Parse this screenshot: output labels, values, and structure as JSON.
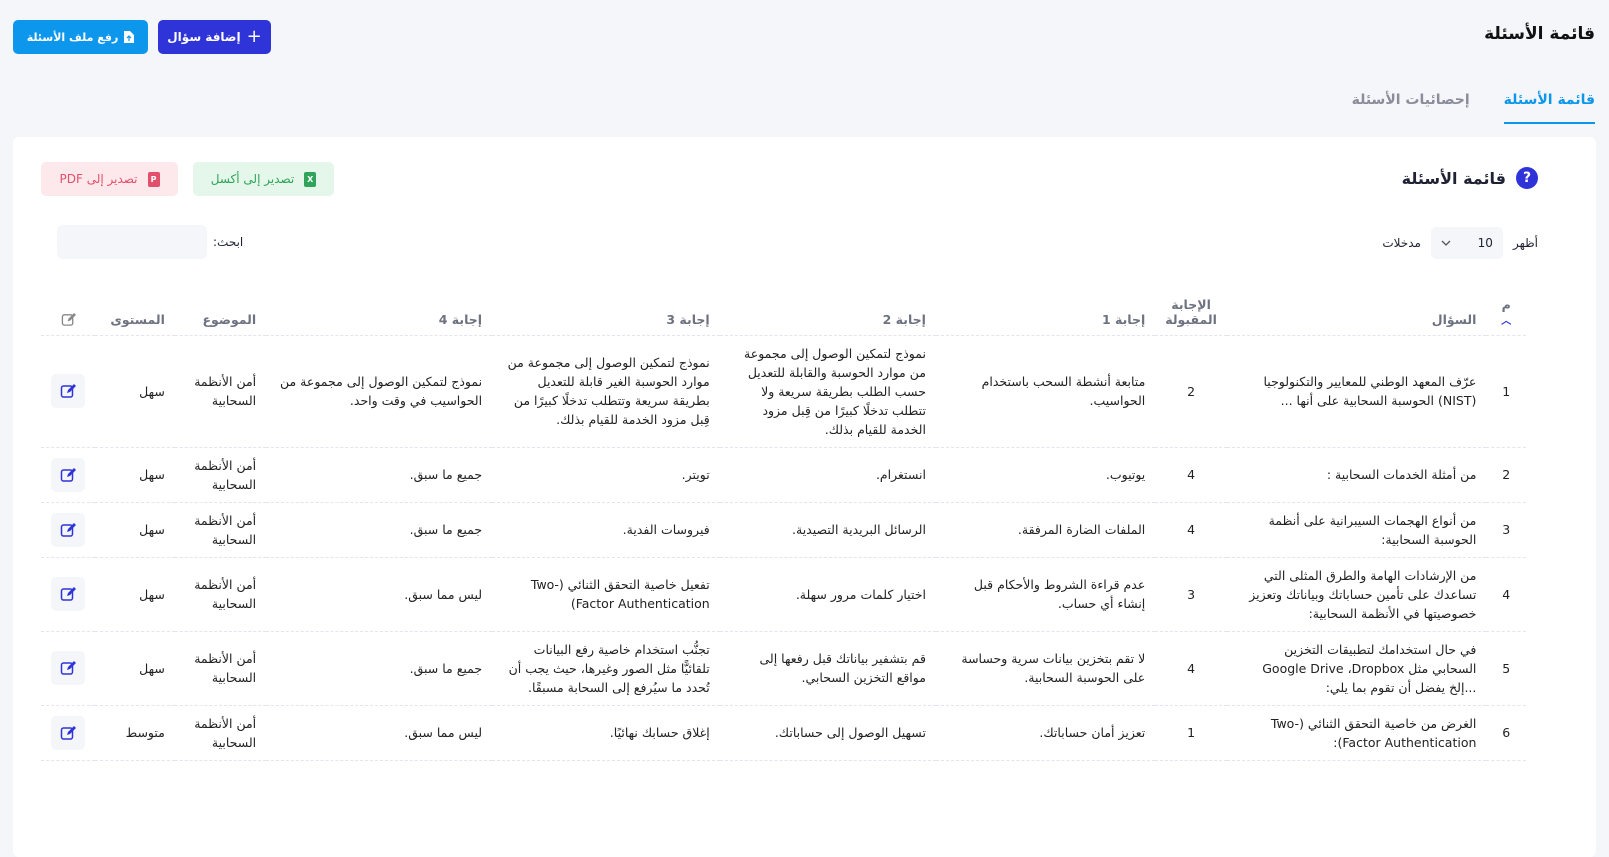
{
  "header": {
    "title": "قائمة الأسئلة",
    "add_button": "إضافة سؤال",
    "upload_button": "رفع ملف الأسئلة"
  },
  "tabs": [
    {
      "label": "قائمة الأسئلة",
      "active": true
    },
    {
      "label": "إحصائيات الأسئلة",
      "active": false
    }
  ],
  "card": {
    "title": "قائمة الأسئلة",
    "export_excel": "تصدير إلى أكسل",
    "export_pdf": "تصدير إلى PDF",
    "show_label": "أظهر",
    "page_size": "10",
    "entries_label": "مدخلات",
    "search_label": "ابحث:",
    "search_placeholder": ""
  },
  "table": {
    "columns": {
      "index": "م",
      "question": "السؤال",
      "correct": "الإجابة المقبولة",
      "a1": "إجابة 1",
      "a2": "إجابة 2",
      "a3": "إجابة 3",
      "a4": "إجابة 4",
      "topic": "الموضوع",
      "level": "المستوى"
    },
    "rows": [
      {
        "index": "1",
        "question": "عرّف المعهد الوطني للمعايير والتكنولوجيا (NIST) الحوسبة السحابية على أنها ...",
        "correct": "2",
        "a1": "متابعة أنشطة السحب باستخدام الحواسيب.",
        "a2": "نموذج لتمكين الوصول إلى مجموعة من موارد الحوسبة والقابلة للتعديل حسب الطلب بطريقة سريعة ولا تتطلب تدخلًا كبيرًا من قِبل مزود الخدمة للقيام بذلك.",
        "a3": "نموذج لتمكين الوصول إلى مجموعة من موارد الحوسبة الغير قابلة للتعديل بطريقة سريعة وتتطلب تدخلًا كبيرًا من قِبل مزود الخدمة للقيام بذلك.",
        "a4": "نموذج لتمكين الوصول إلى مجموعة من الحواسيب في وقت واحد.",
        "topic": "أمن الأنظمة السحابية",
        "level": "سهل"
      },
      {
        "index": "2",
        "question": "من أمثلة الخدمات السحابية :",
        "correct": "4",
        "a1": "يوتيوب.",
        "a2": "انستغرام.",
        "a3": "تويتر.",
        "a4": "جميع ما سبق.",
        "topic": "أمن الأنظمة السحابية",
        "level": "سهل"
      },
      {
        "index": "3",
        "question": "من أنواع الهجمات السيبرانية على أنظمة الحوسبة السحابية:",
        "correct": "4",
        "a1": "الملفات الضارة المرفقة.",
        "a2": "الرسائل البريدية التصيدية.",
        "a3": "فيروسات الفدية.",
        "a4": "جميع ما سبق.",
        "topic": "أمن الأنظمة السحابية",
        "level": "سهل"
      },
      {
        "index": "4",
        "question": "من الإرشادات الهامة والطرق المثلى التي تساعدك على تأمين حساباتك وبياناتك وتعزيز خصوصيتها في الأنظمة السحابية:",
        "correct": "3",
        "a1": "عدم قراءة الشروط والأحكام قبل إنشاء أي حساب.",
        "a2": "اختيار كلمات مرور سهلة.",
        "a3": "تفعيل خاصية التحقق الثنائي (-Two Factor Authentication)",
        "a4": "ليس مما سبق.",
        "topic": "أمن الأنظمة السحابية",
        "level": "سهل"
      },
      {
        "index": "5",
        "question": "في حال استخدامك لتطبيقات التخزين السحابي مثل Google Drive ،Dropbox ...إلخ يفضل أن تقوم بما يلي:",
        "correct": "4",
        "a1": "لا تقم بتخزين بيانات سرية وحساسة على الحوسبة السحابية.",
        "a2": "قم بتشفير بياناتك قبل رفعها إلى مواقع التخزين السحابي.",
        "a3": "تجنُّب استخدام خاصية رفع البيانات تلقائيًّا مثل الصور وغيرها، حيث يجب أن تُحدد ما سيُرفع إلى السحابة مسبقًا.",
        "a4": "جميع ما سبق.",
        "topic": "أمن الأنظمة السحابية",
        "level": "سهل"
      },
      {
        "index": "6",
        "question": "الغرض من خاصية التحقق الثنائي (Two-Factor Authentication):",
        "correct": "1",
        "a1": "تعزيز أمان حساباتك.",
        "a2": "تسهيل الوصول إلى حساباتك.",
        "a3": "إغلاق حسابك نهائيًا.",
        "a4": "ليس مما سبق.",
        "topic": "أمن الأنظمة السحابية",
        "level": "متوسط"
      }
    ]
  },
  "colors": {
    "primary": "#2f34d8",
    "info": "#0d97ec",
    "success": "#2fa45a",
    "danger": "#e2506b"
  }
}
